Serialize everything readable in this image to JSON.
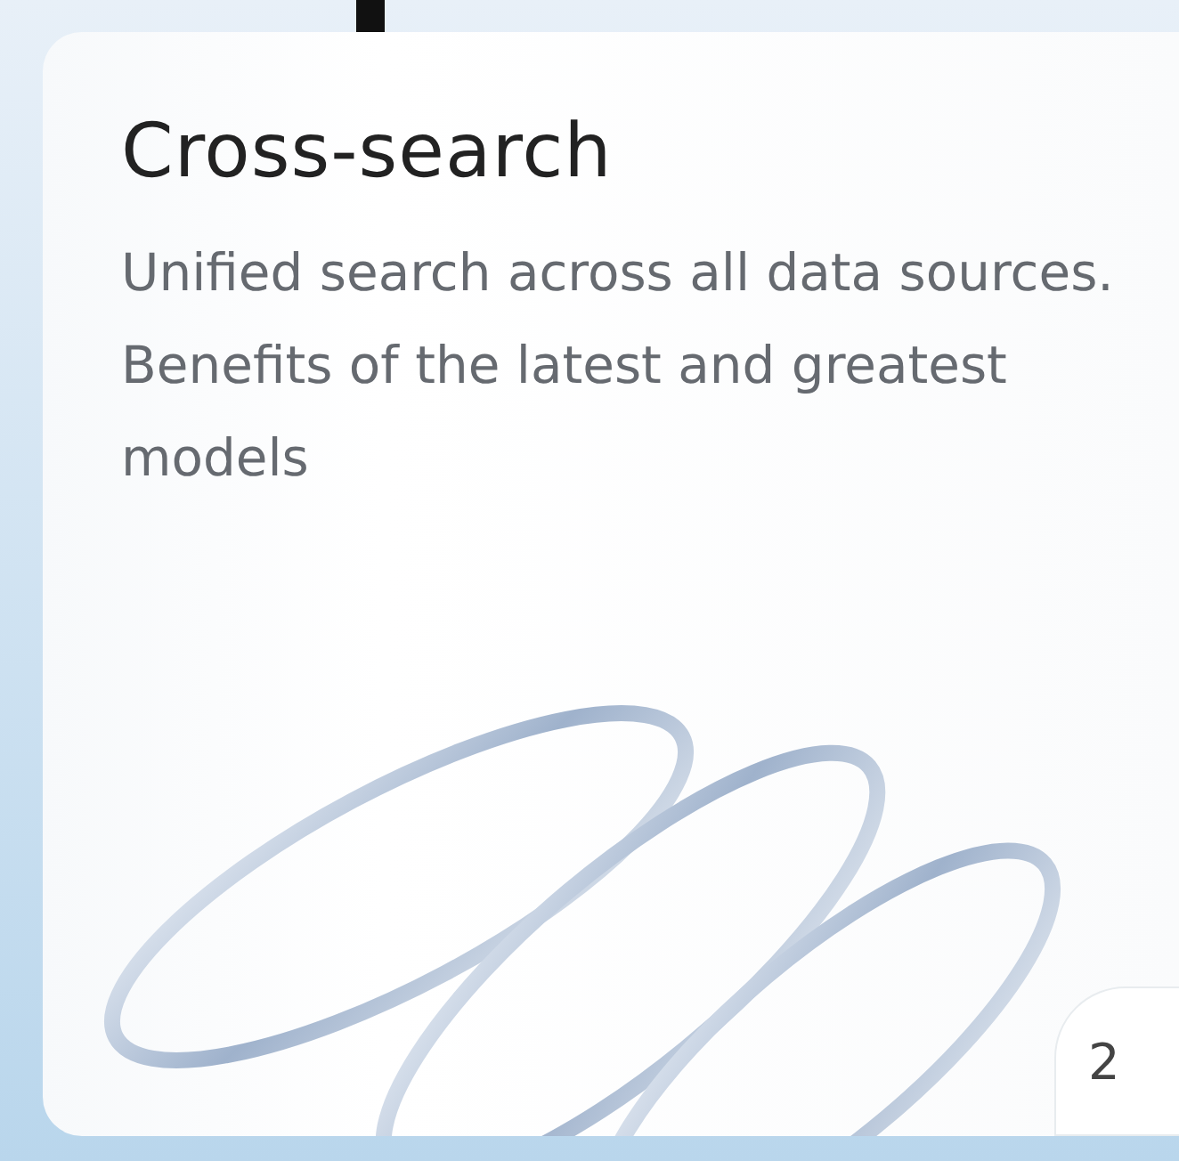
{
  "card": {
    "title": "Cross-search",
    "description": "Unified search across all data sources. Benefits of the latest and greatest models",
    "number": "2"
  }
}
